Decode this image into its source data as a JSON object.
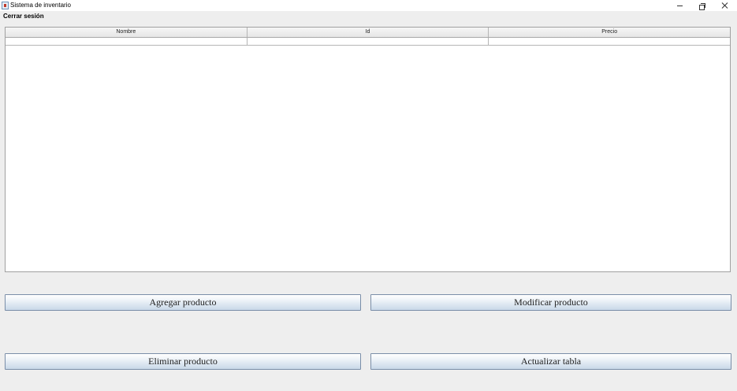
{
  "window": {
    "title": "Sistema de inventario",
    "controls": [
      "minimize",
      "restore",
      "close"
    ]
  },
  "menubar": {
    "items": [
      {
        "label": "Cerrar sesión"
      }
    ]
  },
  "table": {
    "columns": [
      "Nombre",
      "Id",
      "Precio"
    ],
    "rows": [
      [
        "",
        "",
        ""
      ]
    ]
  },
  "buttons": {
    "add": "Agregar producto",
    "modify": "Modificar producto",
    "delete": "Eliminar producto",
    "refresh": "Actualizar tabla"
  }
}
